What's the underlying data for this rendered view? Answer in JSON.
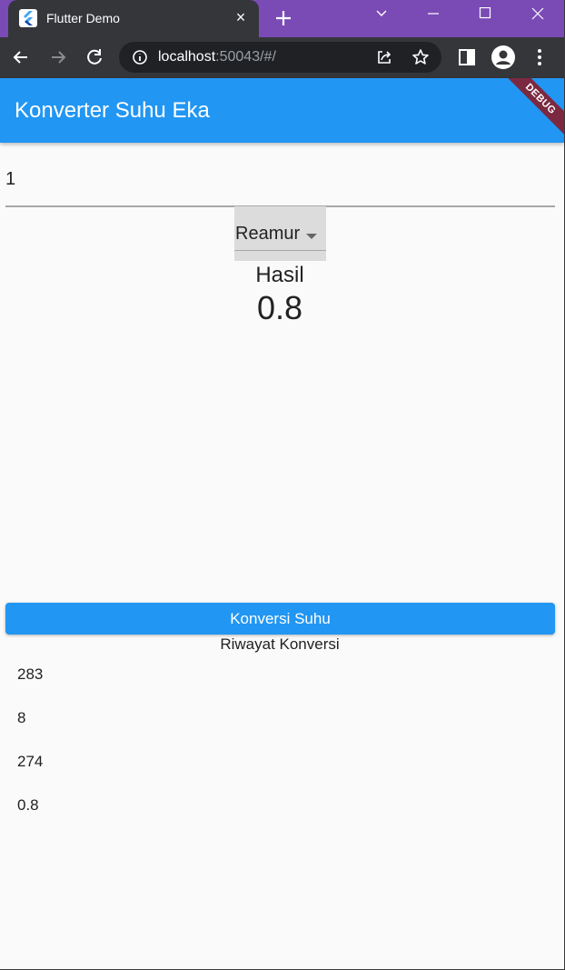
{
  "browser": {
    "tab_title": "Flutter Demo",
    "tab_close": "×",
    "favicon": "flutter-logo",
    "url_host": "localhost",
    "url_rest": ":50043/#/"
  },
  "app": {
    "title": "Konverter Suhu Eka",
    "debug_banner": "DEBUG",
    "accent_color": "#2196f3"
  },
  "form": {
    "input_value": "1",
    "selected_unit": "Reamur"
  },
  "result": {
    "label": "Hasil",
    "value": "0.8"
  },
  "convert_button": {
    "label": "Konversi Suhu"
  },
  "history": {
    "title": "Riwayat Konversi",
    "items": [
      "283",
      "8",
      "274",
      "0.8"
    ]
  }
}
